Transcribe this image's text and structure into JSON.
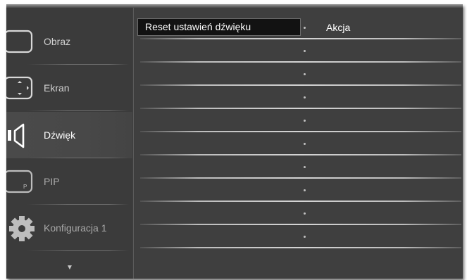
{
  "sidebar": {
    "items": [
      {
        "label": "Obraz",
        "icon": "picture-icon",
        "state": "normal"
      },
      {
        "label": "Ekran",
        "icon": "screen-icon",
        "state": "normal"
      },
      {
        "label": "Dźwięk",
        "icon": "speaker-icon",
        "state": "active"
      },
      {
        "label": "PIP",
        "icon": "pip-icon",
        "state": "dim"
      },
      {
        "label": "Konfiguracja 1",
        "icon": "gear-icon",
        "state": "dim"
      }
    ],
    "more_arrow": "▼"
  },
  "menu": {
    "selected_item": "Reset ustawień dźwięku",
    "selected_value": "Akcja",
    "empty_rows": 9
  },
  "colors": {
    "background": "#3f3f3f",
    "sidebar": "#3b3b3b",
    "selection": "#121212",
    "text": "#ffffff"
  }
}
